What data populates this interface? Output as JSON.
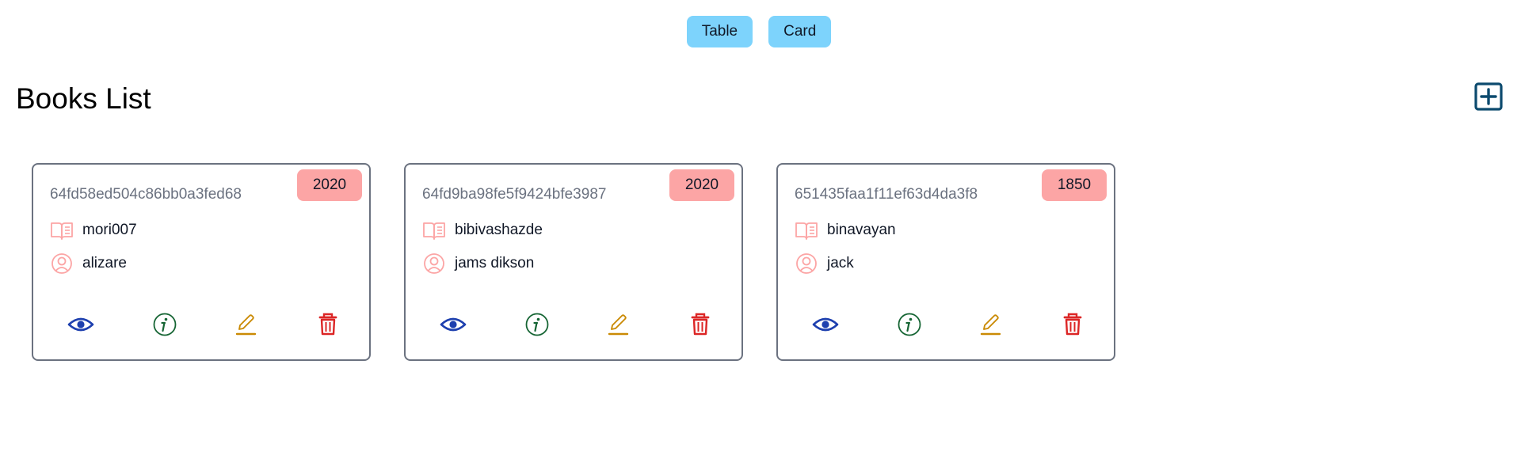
{
  "view_toggle": {
    "table_label": "Table",
    "card_label": "Card"
  },
  "page": {
    "title": "Books List"
  },
  "icons": {
    "add": "plus-square-icon",
    "title": "open-book-icon",
    "author": "user-circle-icon",
    "view": "eye-icon",
    "info": "info-circle-icon",
    "edit": "pencil-icon",
    "delete": "trash-icon"
  },
  "colors": {
    "toggle_bg": "#7dd3fc",
    "badge_bg": "#fca5a5",
    "add_icon": "#0c4a6e",
    "view_icon": "#1e40af",
    "info_icon": "#166534",
    "edit_icon": "#ca8a04",
    "delete_icon": "#dc2626",
    "meta_icon": "#fca5a5"
  },
  "books": [
    {
      "id": "64fd58ed504c86bb0a3fed68",
      "year": "2020",
      "title": "mori007",
      "author": "alizare"
    },
    {
      "id": "64fd9ba98fe5f9424bfe3987",
      "year": "2020",
      "title": "bibivashazde",
      "author": "jams dikson"
    },
    {
      "id": "651435faa1f11ef63d4da3f8",
      "year": "1850",
      "title": "binavayan",
      "author": "jack"
    }
  ]
}
